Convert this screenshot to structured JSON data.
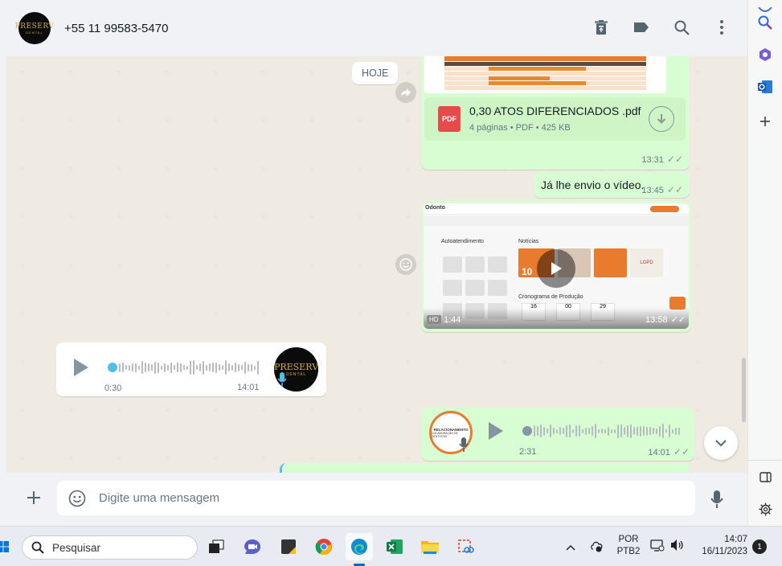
{
  "header": {
    "contact_name": "+55 11 99583-5470",
    "avatar_logo_text": "PRESERV",
    "avatar_logo_sub": "DENTAL"
  },
  "chat": {
    "date_separator": "HOJE",
    "pdf_message": {
      "filename": "0,30 ATOS DIFERENCIADOS .pdf",
      "meta": "4 páginas • PDF • 425 KB",
      "icon_label": "PDF",
      "time": "13:31"
    },
    "text_message": {
      "text": "Já lhe envio o vídeo.",
      "time": "13:45"
    },
    "video_message": {
      "badge": "HD",
      "duration": "1:44",
      "time": "13:58",
      "thumb_section_1": "Autoatendimento",
      "thumb_section_2": "Notícias",
      "thumb_section_3": "Cronograma de Produção",
      "thumb_news_1": "10",
      "thumb_news_2": "LGPD",
      "thumb_cal_1": "16",
      "thumb_cal_2": "00",
      "thumb_cal_3": "29"
    },
    "audio_in": {
      "duration": "0:30",
      "time": "14:01",
      "avatar_logo_text": "PRESERV",
      "avatar_logo_sub": "DENTAL"
    },
    "audio_out": {
      "duration": "2:31",
      "time": "14:01",
      "avatar_text_1": "RELACIONAMENTO",
      "avatar_text_2": "COLABORAÇÃO DE DENTISTAS"
    }
  },
  "compose": {
    "placeholder": "Digite uma mensagem"
  },
  "taskbar": {
    "search_label": "Pesquisar",
    "language_line1": "POR",
    "language_line2": "PTB2",
    "time": "14:07",
    "date": "16/11/2023",
    "notification_count": "1"
  },
  "colors": {
    "outgoing_bubble": "#d9fdd3",
    "incoming_bubble": "#ffffff",
    "chat_background": "#efeae2",
    "header_background": "#f0f2f5",
    "accent_blue": "#53bdeb"
  }
}
